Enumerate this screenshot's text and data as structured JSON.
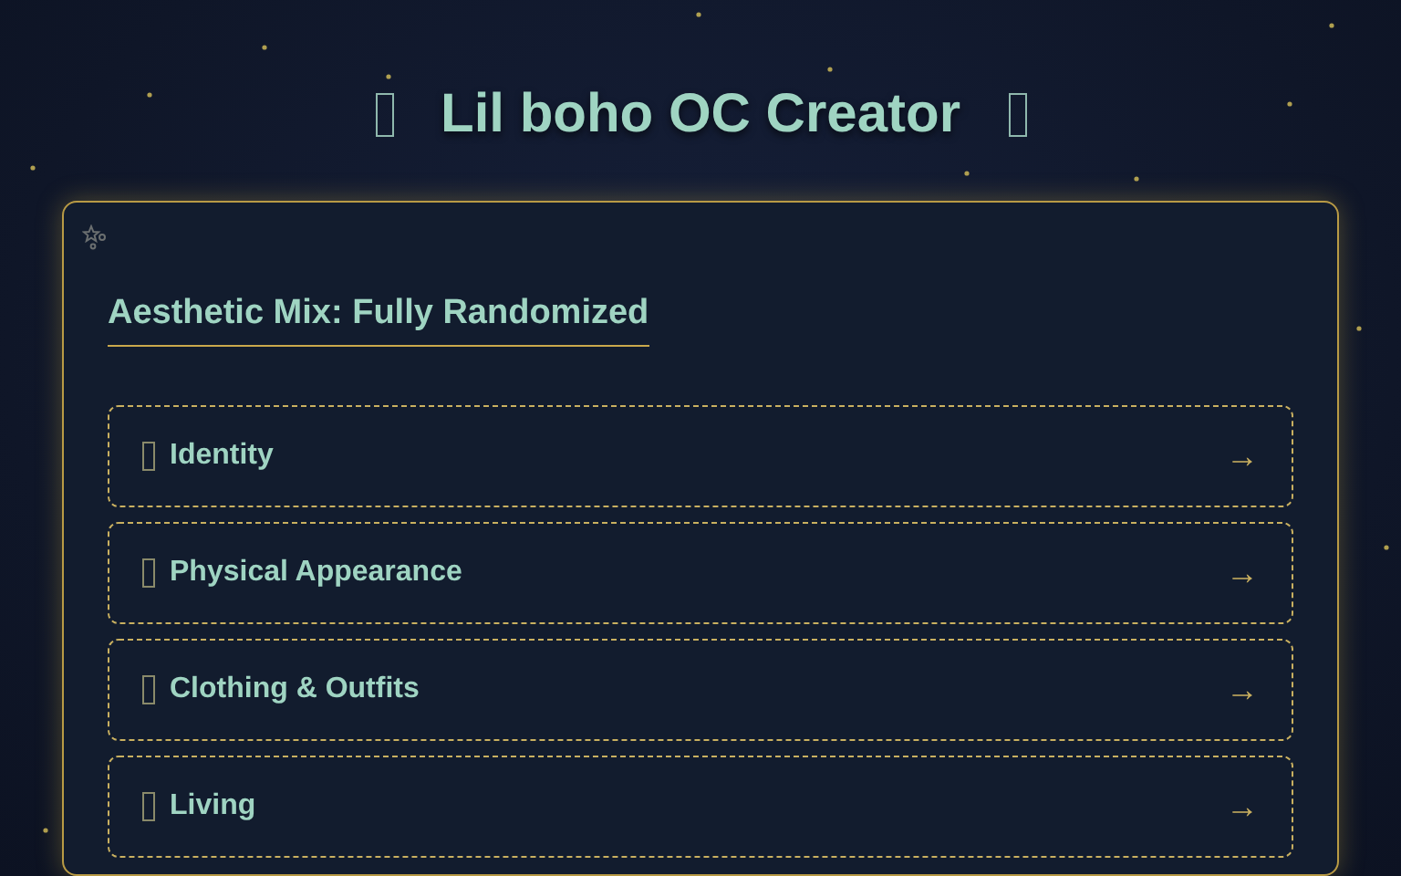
{
  "header": {
    "title": "Lil boho OC Creator"
  },
  "card": {
    "heading": "Aesthetic Mix: Fully Randomized",
    "sections": [
      {
        "label": "Identity",
        "arrow": "→"
      },
      {
        "label": "Physical Appearance",
        "arrow": "→"
      },
      {
        "label": "Clothing & Outfits",
        "arrow": "→"
      },
      {
        "label": "Living",
        "arrow": "→"
      }
    ]
  }
}
